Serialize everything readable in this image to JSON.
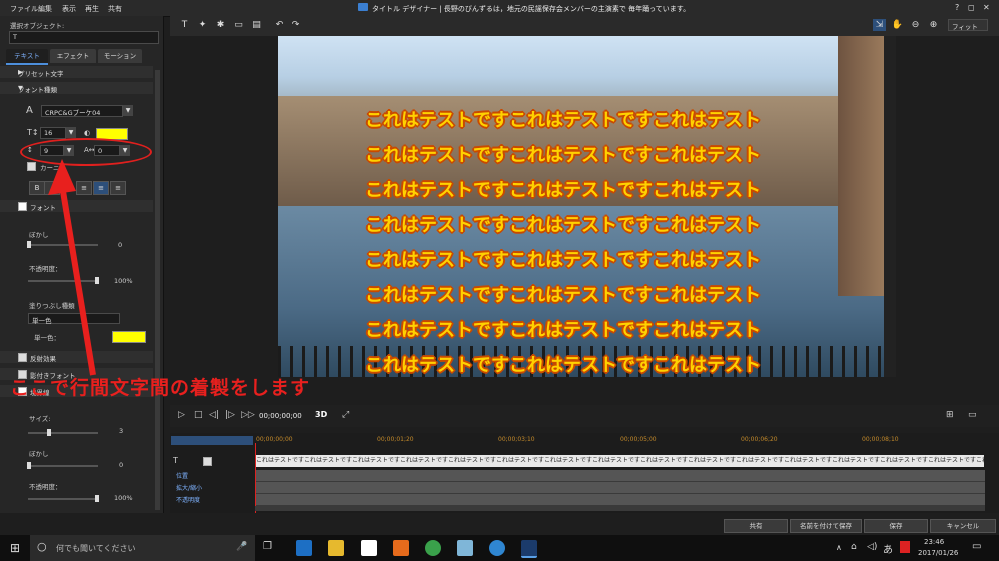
{
  "menubar": {
    "items": [
      "ファイル",
      "編集",
      "表示",
      "再生",
      "共有"
    ],
    "title": "タイトル デザイナー | 長野のびんずるは，地元の民謡保存会メンバーの主演素で 毎年踊っています。",
    "help": "?",
    "restore": "◻",
    "close": "✕"
  },
  "left_panel": {
    "selected_object_label": "選択オブジェクト:",
    "selected_object_value": "T",
    "tabs": [
      "テキスト",
      "エフェクト",
      "モーション"
    ],
    "sections": {
      "preset": "プリセット文字",
      "font_type": "フォント種類",
      "font_face": "フォント",
      "reflection": "反射効果",
      "shadow": "影付きフォント",
      "border": "境界線"
    },
    "font_name": "CRPC&Gブーケ04",
    "font_size": "16",
    "line_spacing": "9",
    "char_spacing": "0",
    "kerning_label": "カーニ",
    "bold": "B",
    "blur_label": "ぼかし",
    "blur_value": "0",
    "opacity_label": "不透明度：",
    "opacity_value": "100%",
    "fill_type_label": "塗りつぶし種類",
    "fill_type_value": "単一色",
    "single_color_label": "単一色：",
    "size_label": "サイズ:",
    "size_value": "3",
    "blur2_label": "ぼかし",
    "blur2_value": "0",
    "opacity2_label": "不透明度：",
    "opacity2_value": "100%"
  },
  "toolbar": {
    "fit": "フィット"
  },
  "preview": {
    "caption_lines": [
      "これはテストですこれはテストですこれはテスト",
      "これはテストですこれはテストですこれはテスト",
      "これはテストですこれはテストですこれはテスト",
      "これはテストですこれはテストですこれはテスト",
      "これはテストですこれはテストですこれはテスト",
      "これはテストですこれはテストですこれはテスト",
      "これはテストですこれはテストですこれはテスト",
      "これはテストですこれはテストですこれはテスト"
    ]
  },
  "playback": {
    "timecode": "00;00;00;00",
    "mode3d": "3D"
  },
  "timeline": {
    "ruler": [
      "00;00;00;00",
      "00;00;01;20",
      "00;00;03;10",
      "00;00;05;00",
      "00;00;06;20",
      "00;00;08;10"
    ],
    "text_track_label": "T",
    "clip_text": "これはテストですこれはテストですこれはテストですこれはテストですこれはテストですこれはテストですこれはテストですこれはテストですこれはテストですこれはテストですこれはテストですこれはテストですこれはテストですこれはテストですこれはテストですこれはテストですこれはテストですこれはテスト",
    "tracks": [
      "位置",
      "拡大/縮小",
      "不透明度"
    ]
  },
  "buttons": {
    "share": "共有",
    "save_as": "名前を付けて保存",
    "save": "保存",
    "cancel": "キャンセル"
  },
  "taskbar": {
    "search_placeholder": "何でも聞いてください",
    "time": "23:46",
    "date": "2017/01/26",
    "ime": "あ"
  },
  "annotation": {
    "text": "ここで行間文字間の着製をします"
  },
  "colors": {
    "caption_fill": "#ffd200",
    "caption_outline": "#c94a00",
    "annotation": "#e8201e",
    "swatch": "#ffff00"
  }
}
